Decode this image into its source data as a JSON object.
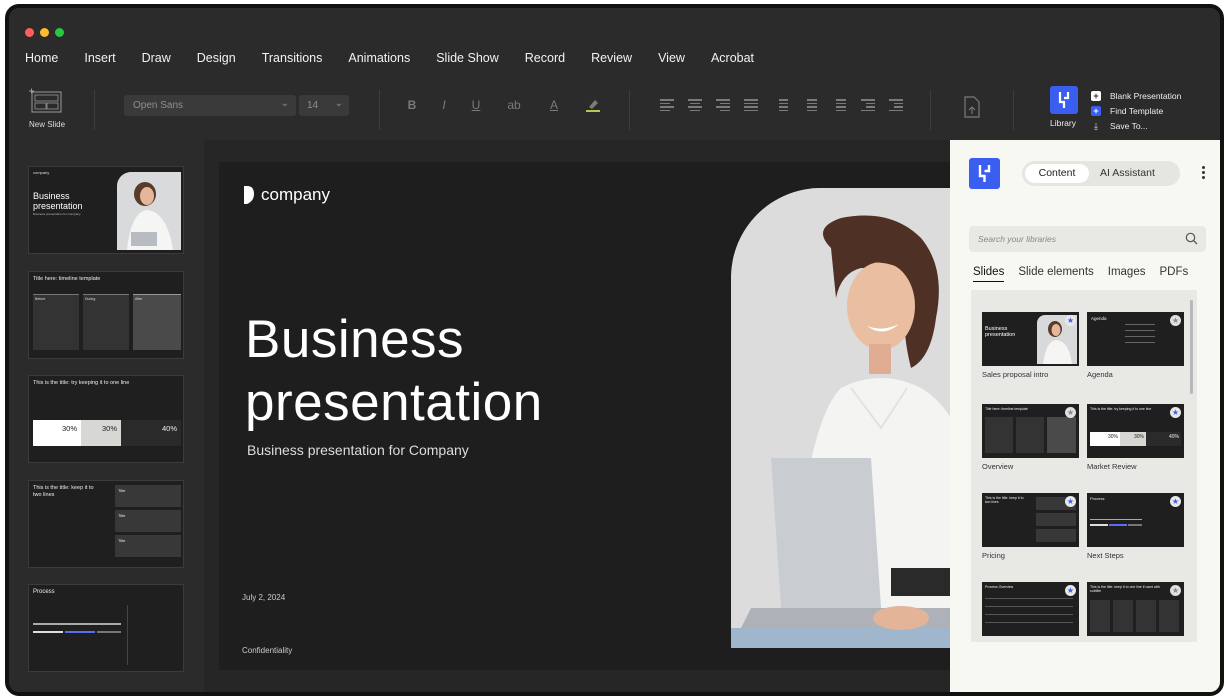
{
  "window": {
    "traffic_colors": [
      "#ff5f57",
      "#febc2e",
      "#28c840"
    ]
  },
  "menu": [
    "Home",
    "Insert",
    "Draw",
    "Design",
    "Transitions",
    "Animations",
    "Slide Show",
    "Record",
    "Review",
    "View",
    "Acrobat"
  ],
  "toolbar": {
    "new_slide": "New Slide",
    "font": "Open Sans",
    "font_size": "14",
    "format": {
      "bold": "B",
      "italic": "I",
      "underline": "U",
      "strike": "ab",
      "font_color": "A"
    },
    "library_label": "Library",
    "quick_actions": [
      {
        "label": "Blank Presentation",
        "icon": "plus-square-icon"
      },
      {
        "label": "Find Template",
        "icon": "plus-square-blue-icon"
      },
      {
        "label": "Save To...",
        "icon": "download-icon"
      }
    ]
  },
  "thumbnails": [
    {
      "title": "Business\npresentation",
      "subtitle": "Business presentation for Company",
      "kind": "cover"
    },
    {
      "title": "Title here: timeline template",
      "columns": [
        "Before",
        "During",
        "After"
      ],
      "kind": "timeline"
    },
    {
      "title": "This is the title: try keeping it to one line",
      "stats": [
        "30%",
        "30%",
        "40%"
      ],
      "kind": "stats"
    },
    {
      "title": "This is the title: keep it to\ntwo lines",
      "cards": [
        "Title",
        "Title",
        "Title"
      ],
      "kind": "cards"
    },
    {
      "title": "Process",
      "kind": "process"
    }
  ],
  "slide": {
    "logo_text": "company",
    "title_line1": "Business",
    "title_line2": "presentation",
    "subtitle": "Business presentation for Company",
    "date": "July 2, 2024",
    "footer": "Confidentiality"
  },
  "panel": {
    "segments": {
      "active": "Content",
      "inactive": "AI Assistant"
    },
    "search_placeholder": "Search your libraries",
    "tabs": [
      "Slides",
      "Slide elements",
      "Images",
      "PDFs"
    ],
    "active_tab": "Slides",
    "cards": [
      {
        "caption": "Sales proposal intro",
        "title": "Business\npresentation",
        "starred": true
      },
      {
        "caption": "Agenda",
        "title": "Agenda",
        "starred": false
      },
      {
        "caption": "Overview",
        "title": "Title here: timeline template",
        "starred": false
      },
      {
        "caption": "Market Review",
        "title": "This is the title: try keeping it to one line",
        "starred": true
      },
      {
        "caption": "Pricing",
        "title": "This is the title: keep it to two lines",
        "starred": true
      },
      {
        "caption": "Next Steps",
        "title": "Process",
        "starred": true
      },
      {
        "caption": "",
        "title": "Process Overview",
        "starred": true
      },
      {
        "caption": "",
        "title": "This is the title: keep it to one line if used with subtitle",
        "starred": false
      }
    ],
    "accent": "#3a5ef0"
  }
}
